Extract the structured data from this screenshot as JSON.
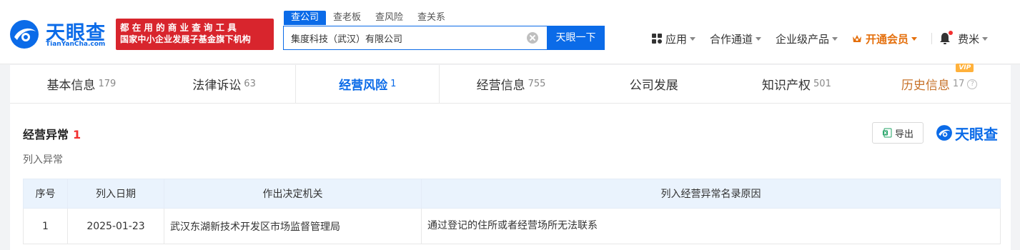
{
  "header": {
    "logo_text": "天眼查",
    "logo_sub": "TianYanCha.com",
    "banner_top": "都在用的商业查询工具",
    "banner_bottom": "国家中小企业发展子基金旗下机构",
    "search_tabs": [
      "查公司",
      "查老板",
      "查风险",
      "查关系"
    ],
    "search_value": "集度科技（武汉）有限公司",
    "search_button": "天眼一下",
    "nav": {
      "apps": "应用",
      "partner": "合作通道",
      "enterprise": "企业级产品",
      "vip": "开通会员",
      "user": "费米"
    }
  },
  "tabs": [
    {
      "label": "基本信息",
      "count": "179"
    },
    {
      "label": "法律诉讼",
      "count": "63"
    },
    {
      "label": "经营风险",
      "count": "1"
    },
    {
      "label": "经营信息",
      "count": "755"
    },
    {
      "label": "公司发展",
      "count": ""
    },
    {
      "label": "知识产权",
      "count": "501"
    },
    {
      "label": "历史信息",
      "count": "17",
      "badge": "VIP"
    }
  ],
  "section": {
    "title": "经营异常",
    "count": "1",
    "subtitle": "列入异常",
    "export_label": "导出",
    "brand": "天眼查"
  },
  "table": {
    "headers": [
      "序号",
      "列入日期",
      "作出决定机关",
      "列入经营异常名录原因"
    ],
    "rows": [
      [
        "1",
        "2025-01-23",
        "武汉东湖新技术开发区市场监督管理局",
        "通过登记的住所或者经营场所无法联系"
      ]
    ]
  },
  "colors": {
    "accent": "#0b6be8",
    "banner": "#d8252d",
    "vip": "#e46f0c",
    "alert": "#f23030"
  }
}
